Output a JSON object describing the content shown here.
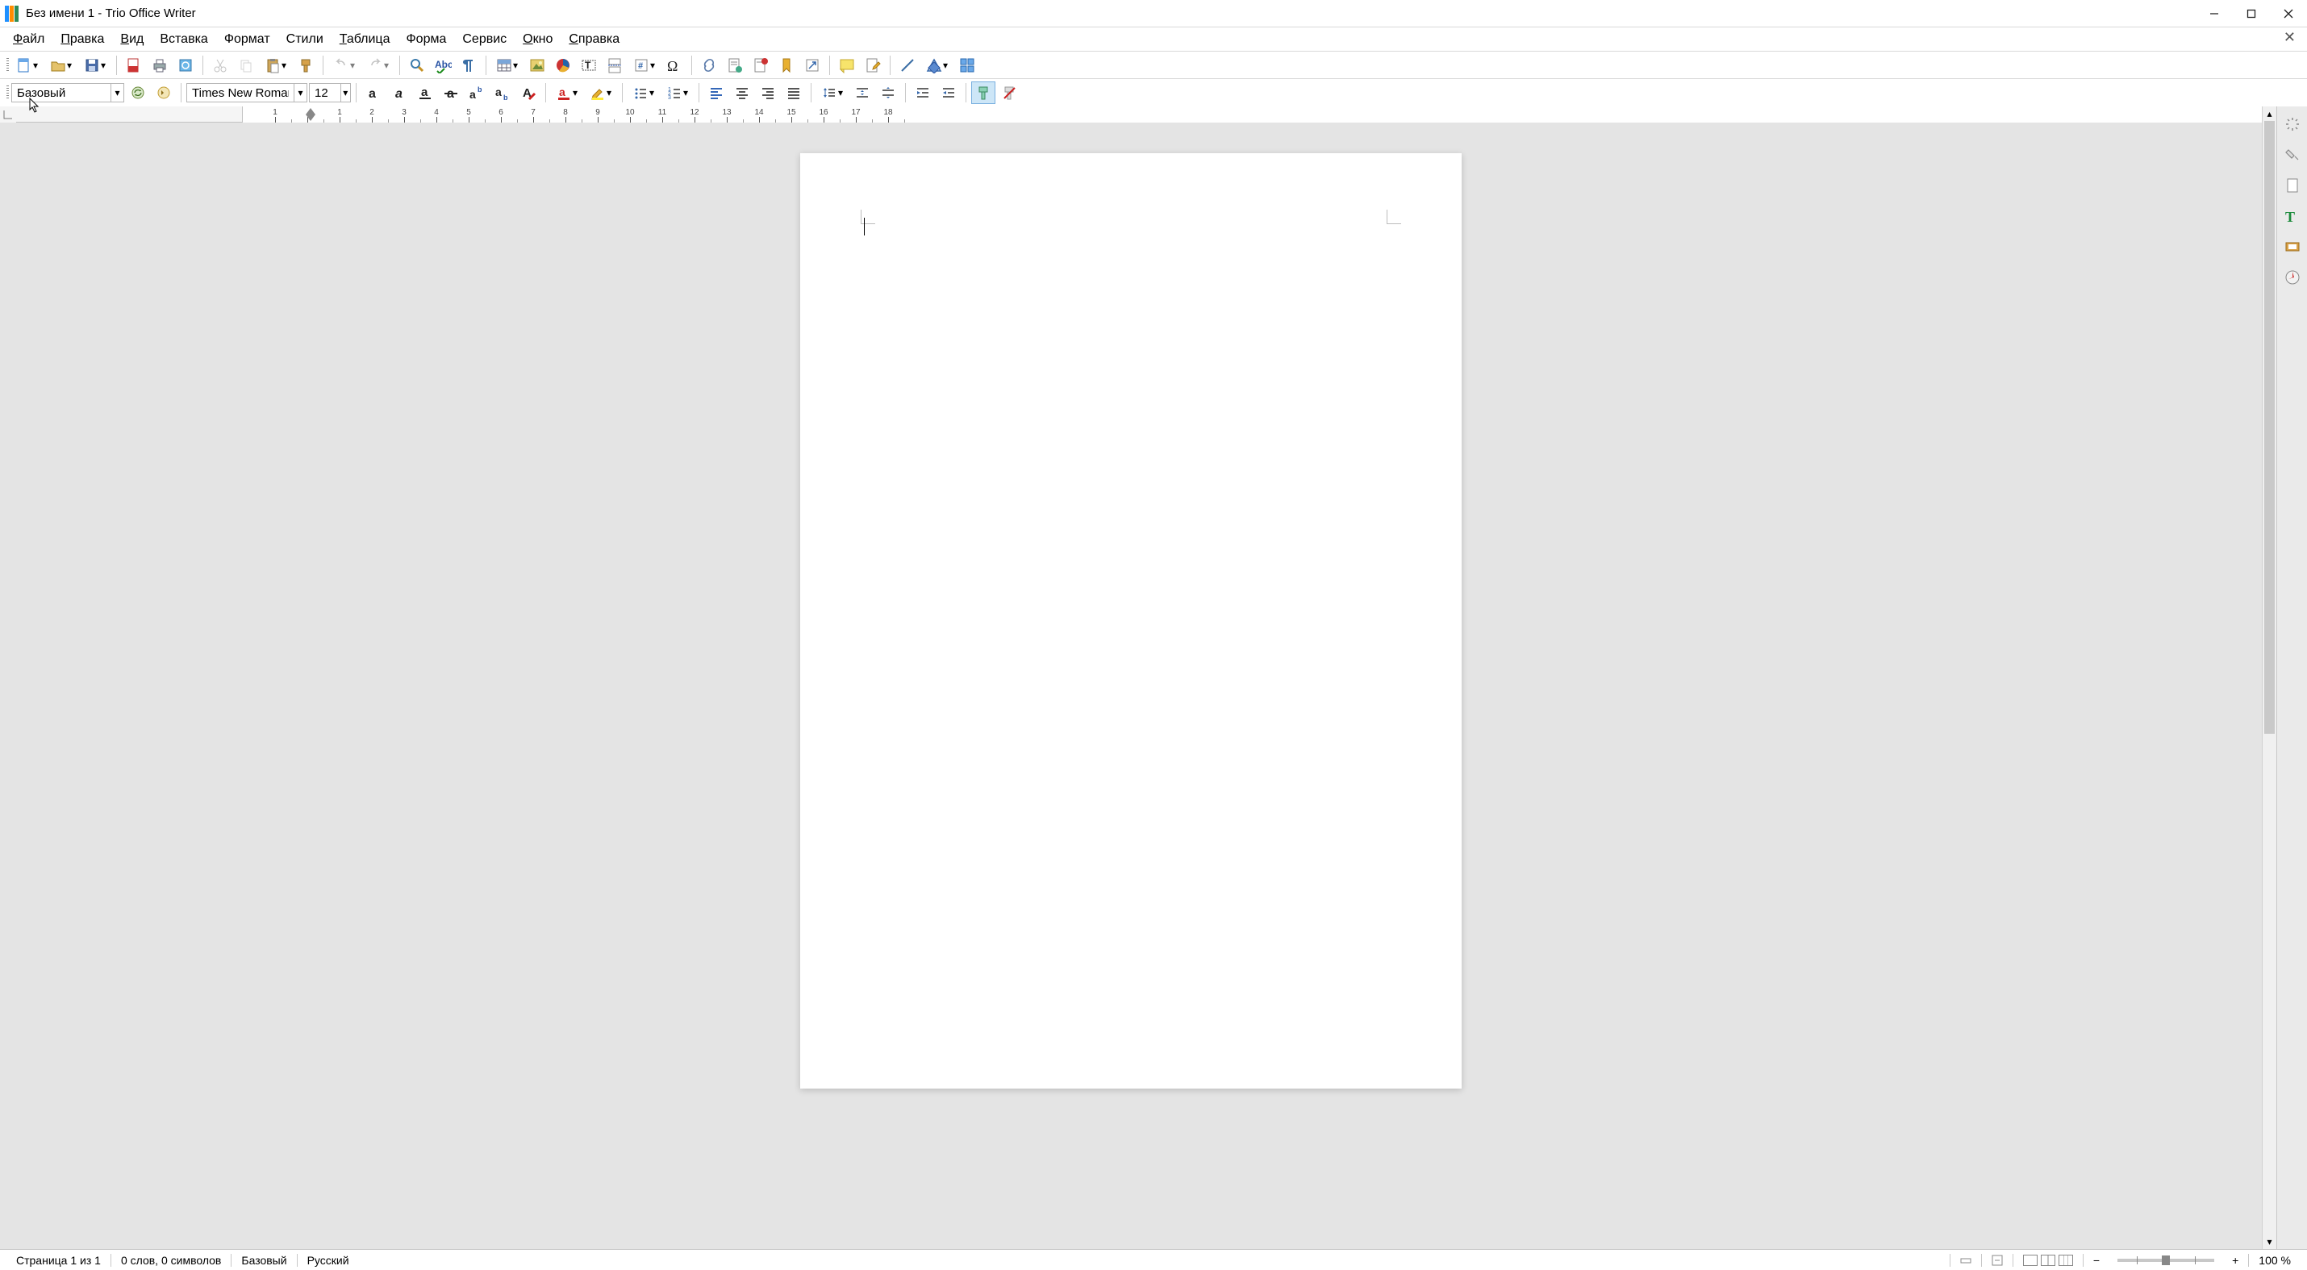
{
  "titlebar": {
    "title": "Без имени 1 - Trio Office Writer"
  },
  "menu": {
    "items": [
      {
        "label": "Файл",
        "ul": "Ф"
      },
      {
        "label": "Правка",
        "ul": "П"
      },
      {
        "label": "Вид",
        "ul": "В"
      },
      {
        "label": "Вставка",
        "ul": ""
      },
      {
        "label": "Формат",
        "ul": ""
      },
      {
        "label": "Стили",
        "ul": ""
      },
      {
        "label": "Таблица",
        "ul": "Т"
      },
      {
        "label": "Форма",
        "ul": ""
      },
      {
        "label": "Сервис",
        "ul": ""
      },
      {
        "label": "Окно",
        "ul": "О"
      },
      {
        "label": "Справка",
        "ul": "С"
      }
    ]
  },
  "toolbar1_names": [
    "new-document",
    "open-document",
    "save-document",
    "export-pdf",
    "print",
    "print-preview",
    "cut",
    "copy",
    "paste",
    "format-paintbrush",
    "undo",
    "redo",
    "find-replace",
    "spellcheck",
    "formatting-marks",
    "insert-table",
    "insert-image",
    "insert-chart",
    "insert-text-box",
    "insert-page-break",
    "insert-field",
    "insert-special-char",
    "insert-hyperlink",
    "insert-footnote",
    "insert-endnote",
    "insert-bookmark",
    "insert-cross-ref",
    "insert-comment",
    "track-changes",
    "draw-line",
    "basic-shapes",
    "draw-functions"
  ],
  "formatting": {
    "style": "Базовый",
    "font": "Times New Roman",
    "size": "12"
  },
  "ruler": {
    "numbers": [
      "1",
      "",
      "1",
      "2",
      "3",
      "4",
      "5",
      "6",
      "7",
      "8",
      "9",
      "10",
      "11",
      "12",
      "13",
      "14",
      "15",
      "16",
      "17",
      "18"
    ]
  },
  "status": {
    "page": "Страница 1 из 1",
    "words": "0 слов, 0 символов",
    "style": "Базовый",
    "language": "Русский",
    "zoom": "100 %"
  }
}
